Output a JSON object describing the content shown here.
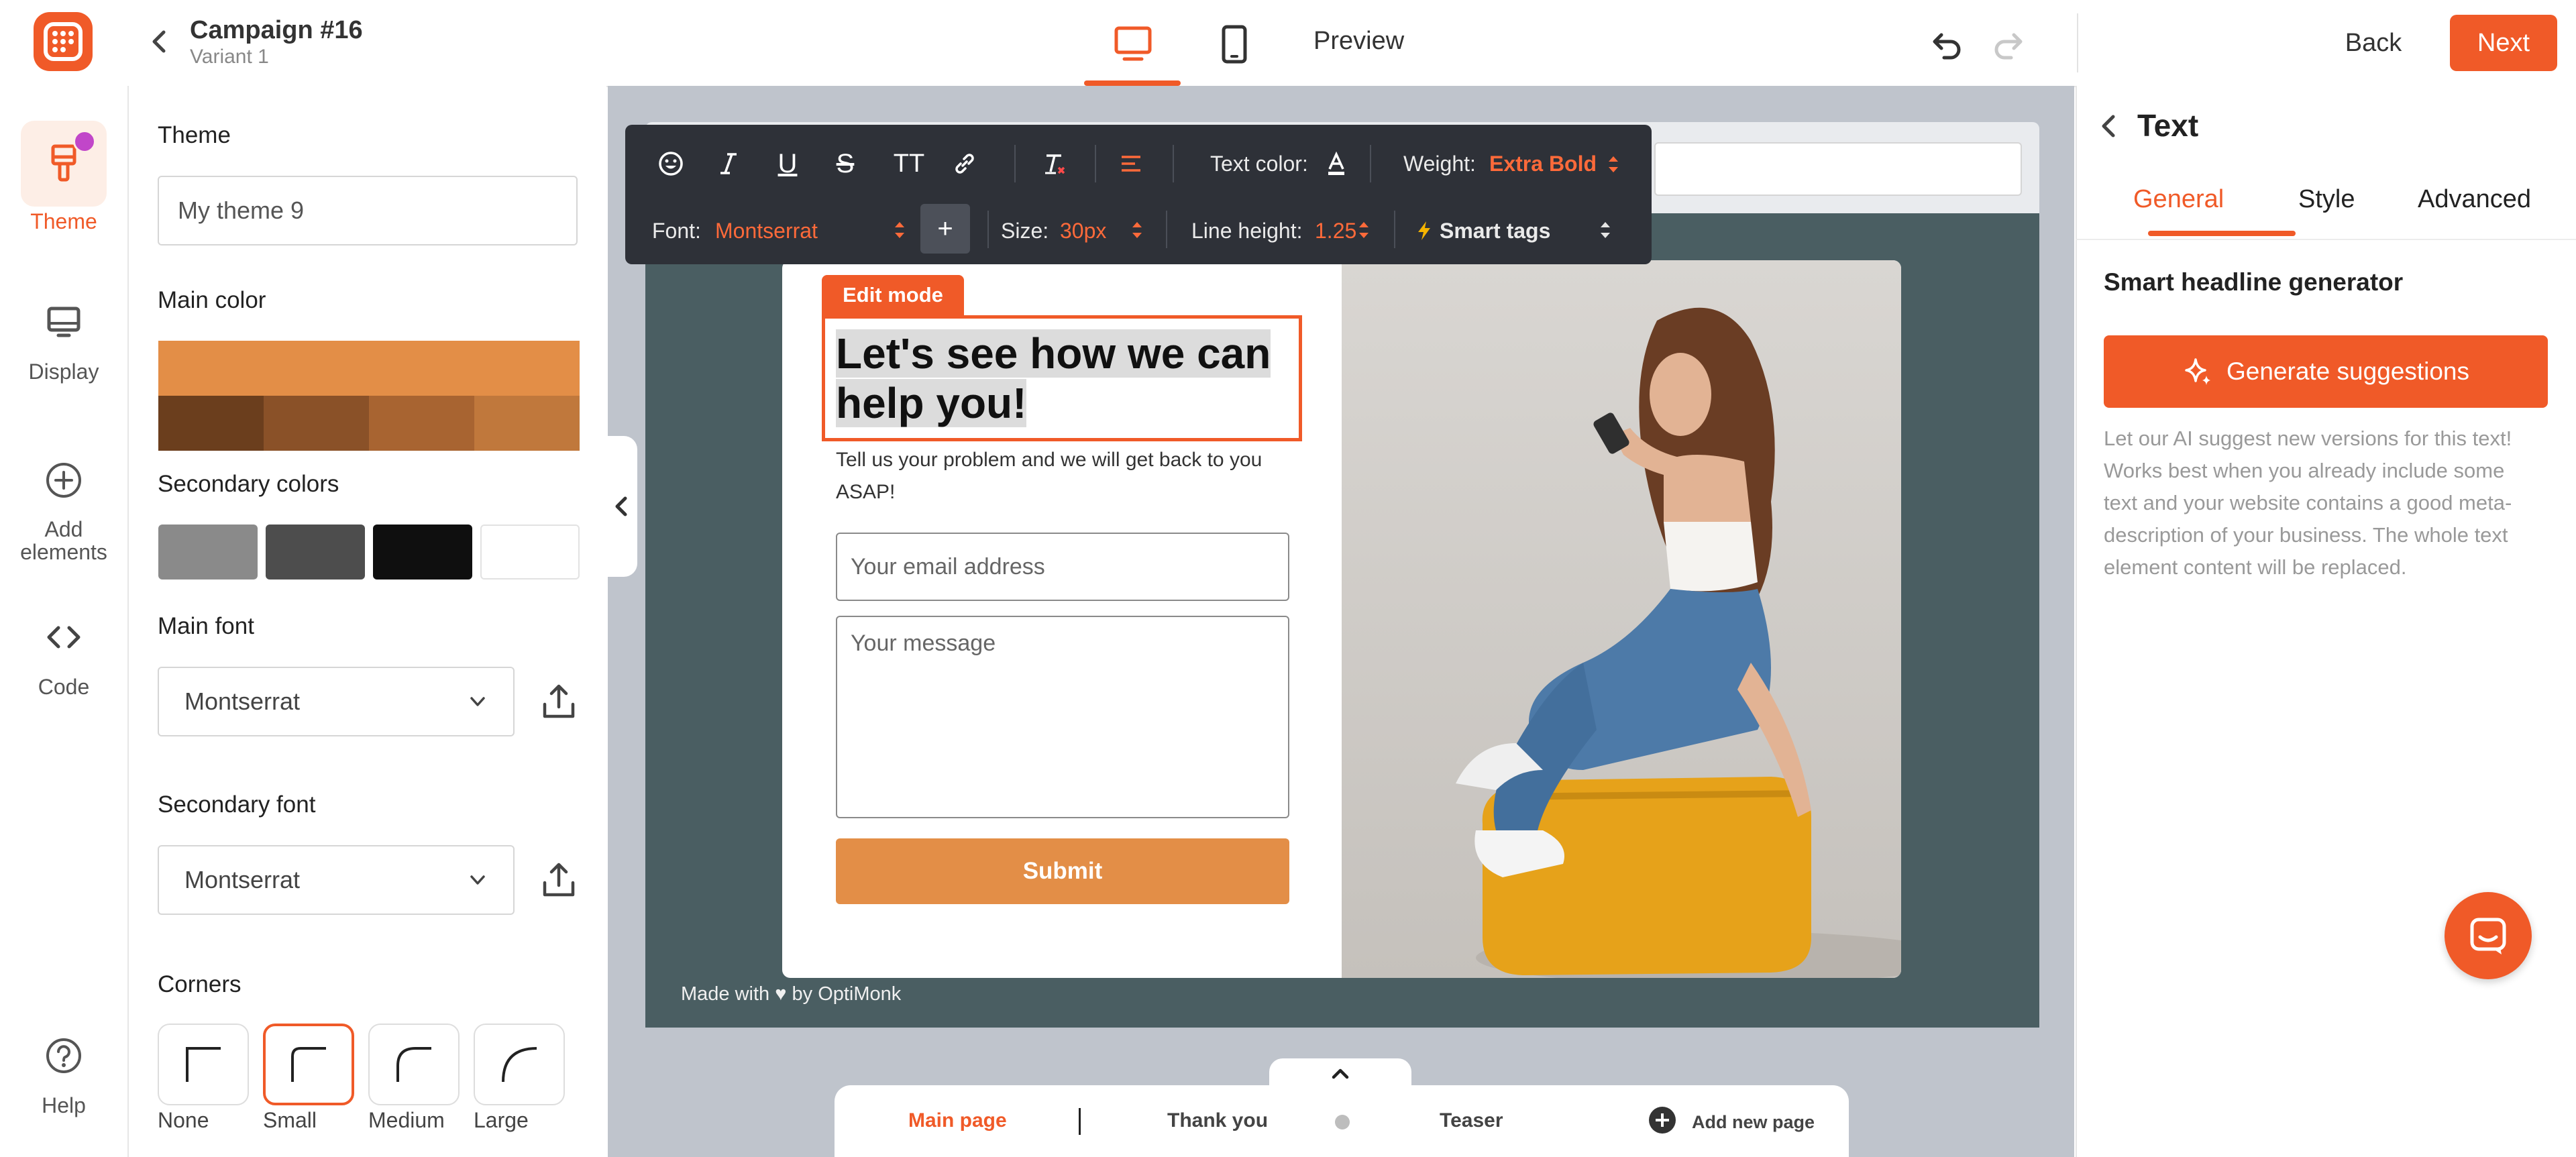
{
  "header": {
    "campaign_title": "Campaign #16",
    "variant": "Variant 1",
    "preview_label": "Preview",
    "back_label": "Back",
    "next_label": "Next",
    "accent_color": "#f05a28"
  },
  "rail": {
    "items": [
      {
        "label": "Theme",
        "icon": "paint-brush-icon",
        "active": true
      },
      {
        "label": "Display",
        "icon": "monitor-icon"
      },
      {
        "label": "Add elements",
        "icon": "plus-circle-icon"
      },
      {
        "label": "Code",
        "icon": "code-icon"
      },
      {
        "label": "Help",
        "icon": "help-circle-icon"
      }
    ]
  },
  "theme_panel": {
    "theme_label": "Theme",
    "theme_value": "My theme 9",
    "main_color_label": "Main color",
    "main_color": "#e38e47",
    "main_color_shades": [
      "#6b3e1d",
      "#8a5128",
      "#a86431",
      "#c0783c"
    ],
    "secondary_colors_label": "Secondary colors",
    "secondary_colors": [
      "#8a8a8a",
      "#4d4d4d",
      "#0f0f0f",
      "#ffffff"
    ],
    "main_font_label": "Main font",
    "main_font_value": "Montserrat",
    "secondary_font_label": "Secondary font",
    "secondary_font_value": "Montserrat",
    "corners_label": "Corners",
    "corners": [
      {
        "label": "None"
      },
      {
        "label": "Small",
        "selected": true
      },
      {
        "label": "Medium"
      },
      {
        "label": "Large"
      }
    ]
  },
  "toolbar": {
    "text_color_label": "Text color:",
    "weight_label": "Weight:",
    "weight_value": "Extra Bold",
    "font_label": "Font:",
    "font_value": "Montserrat",
    "plus_label": "+",
    "size_label": "Size:",
    "size_value": "30px",
    "line_height_label": "Line height:",
    "line_height_value": "1.25",
    "smart_tags_label": "Smart tags",
    "underline_glyph": "U",
    "strike_glyph": "S",
    "tt_glyph": "TT"
  },
  "popup": {
    "edit_mode_label": "Edit mode",
    "headline": "Let's see how we can help you!",
    "subtext": "Tell us your problem and we will get back to you ASAP!",
    "email_placeholder": "Your email address",
    "message_placeholder": "Your message",
    "submit_label": "Submit",
    "made_with": "Made with ♥ by OptiMonk",
    "stage_color": "#4a5e62"
  },
  "pages": {
    "main_page": "Main page",
    "thank_you": "Thank you",
    "teaser": "Teaser",
    "add_new_page": "Add new page"
  },
  "right_panel": {
    "title": "Text",
    "tabs": [
      {
        "label": "General",
        "active": true
      },
      {
        "label": "Style"
      },
      {
        "label": "Advanced"
      }
    ],
    "section_title": "Smart headline generator",
    "generate_label": "Generate suggestions",
    "help_text": "Let our AI suggest new versions for this text! Works best when you already include some text and your website contains a good meta-description of your business. The whole text element content will be replaced."
  }
}
